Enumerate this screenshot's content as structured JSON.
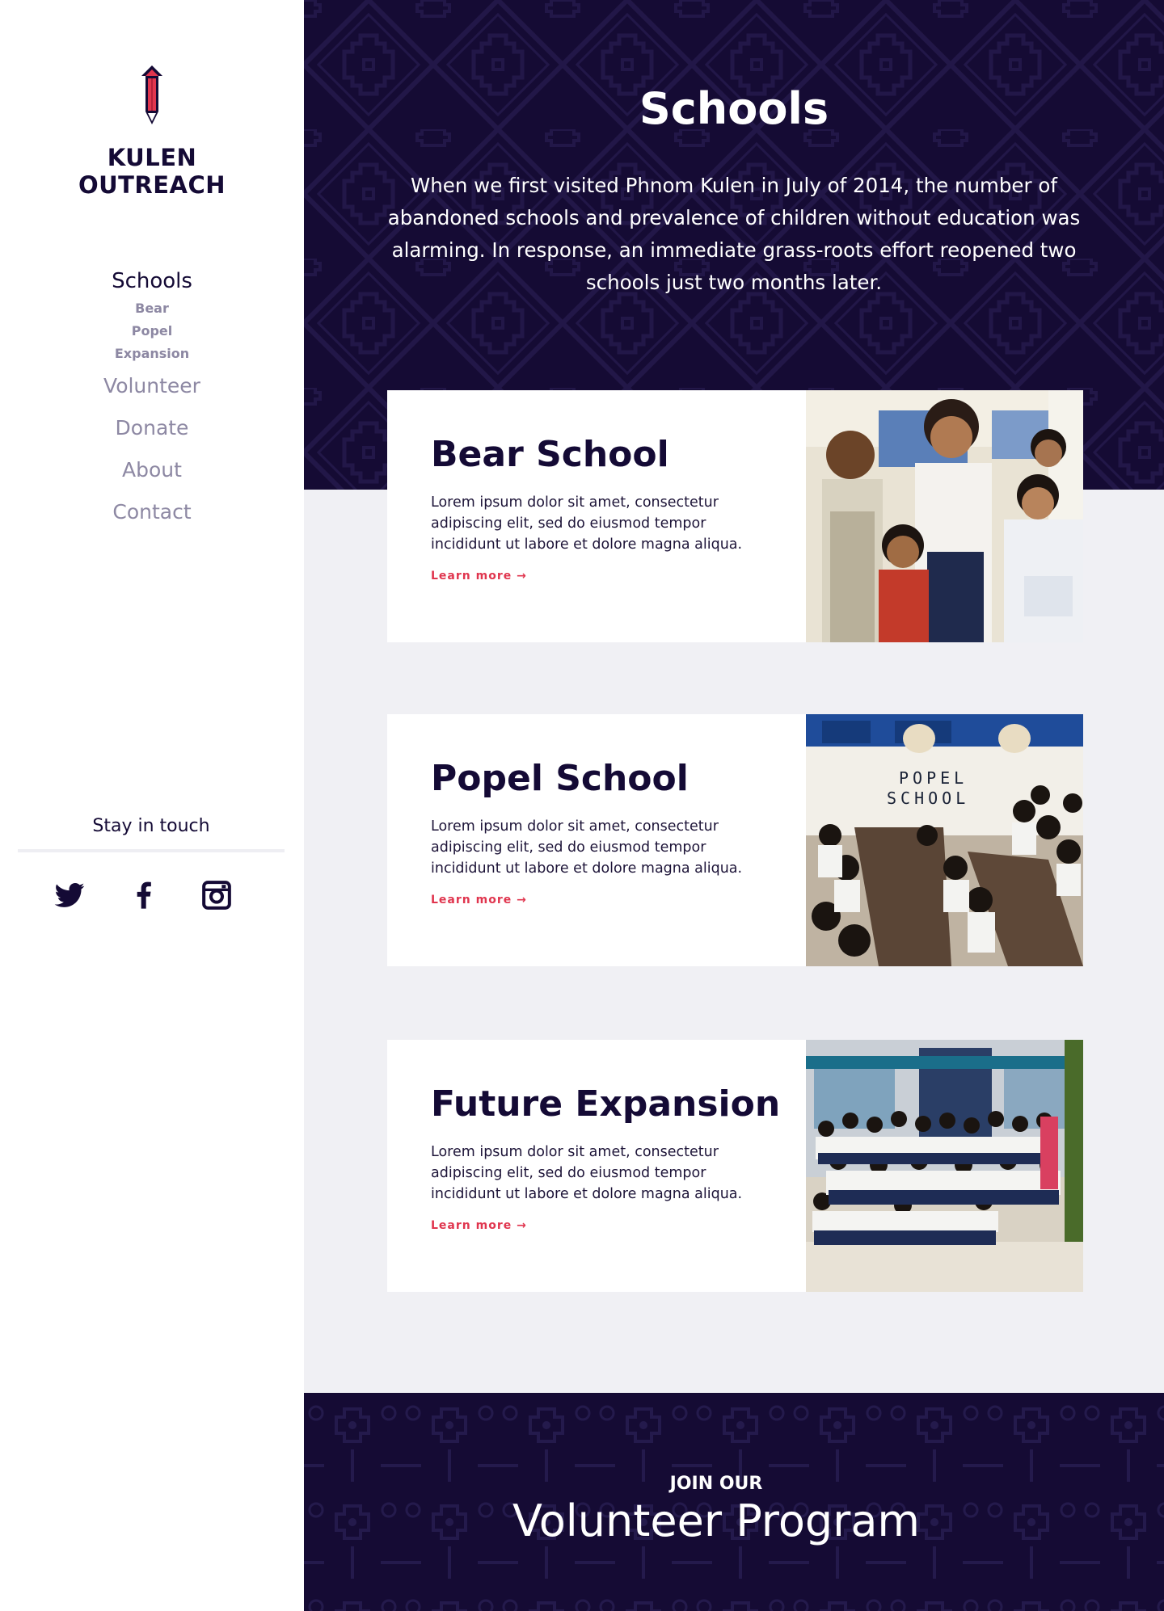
{
  "brand": {
    "line1": "KULEN",
    "line2": "OUTREACH",
    "icon": "pencil-logo-icon"
  },
  "nav": {
    "active": "Schools",
    "sub": [
      "Bear",
      "Popel",
      "Expansion"
    ],
    "items": [
      "Volunteer",
      "Donate",
      "About",
      "Contact"
    ]
  },
  "social": {
    "title": "Stay in touch",
    "icons": [
      "twitter-icon",
      "facebook-icon",
      "instagram-icon"
    ]
  },
  "hero": {
    "title": "Schools",
    "text": "When we first visited Phnom Kulen in July of 2014, the number of abandoned schools and prevalence of children without education was alarming. In response, an immediate grass-roots effort reopened two schools just two months later."
  },
  "cards": [
    {
      "title": "Bear School",
      "text": "Lorem ipsum dolor sit amet, consectetur adipiscing elit, sed do eiusmod tempor incididunt ut labore et dolore magna aliqua.",
      "link": "Learn more →"
    },
    {
      "title": "Popel School",
      "text": "Lorem ipsum dolor sit amet, consectetur adipiscing elit, sed do eiusmod tempor incididunt ut labore et dolore magna aliqua.",
      "link": "Learn more →",
      "sign": [
        "POPEL",
        "SCHOOL"
      ]
    },
    {
      "title": "Future Expansion",
      "text": "Lorem ipsum dolor sit amet, consectetur adipiscing elit, sed do eiusmod tempor incididunt ut labore et dolore magna aliqua.",
      "link": "Learn more →"
    }
  ],
  "footer": {
    "kicker": "JOIN OUR",
    "title": "Volunteer Program"
  },
  "colors": {
    "navy": "#150b34",
    "accent": "#e0354e",
    "muted": "#8d88a3",
    "background": "#f0f0f4"
  }
}
